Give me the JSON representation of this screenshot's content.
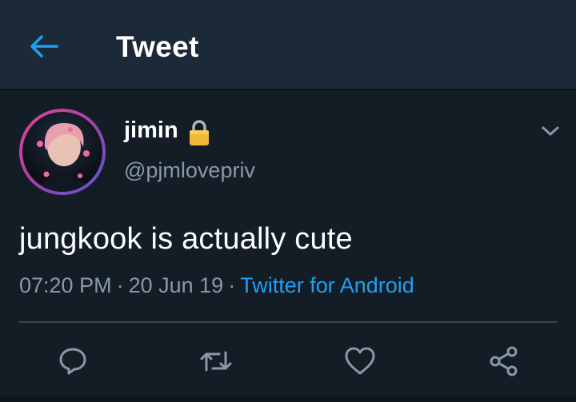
{
  "header": {
    "title": "Tweet",
    "back_icon": "arrow-left-icon"
  },
  "tweet": {
    "display_name": "jimin",
    "protected_icon": "lock-icon",
    "handle": "@pjmlovepriv",
    "text": "jungkook is actually cute",
    "time": "07:20 PM",
    "date": "20 Jun 19",
    "separator": "·",
    "source": "Twitter for Android",
    "menu_icon": "chevron-down-icon"
  },
  "actions": [
    {
      "icon": "reply-icon"
    },
    {
      "icon": "retweet-icon"
    },
    {
      "icon": "heart-icon"
    },
    {
      "icon": "share-icon"
    }
  ],
  "colors": {
    "background": "#141d26",
    "header_background": "#1c2938",
    "accent": "#1da1f2",
    "muted_text": "#8899a6",
    "divider": "#38444d",
    "avatar_ring_start": "#e0478e",
    "avatar_ring_end": "#4b5bd3"
  }
}
